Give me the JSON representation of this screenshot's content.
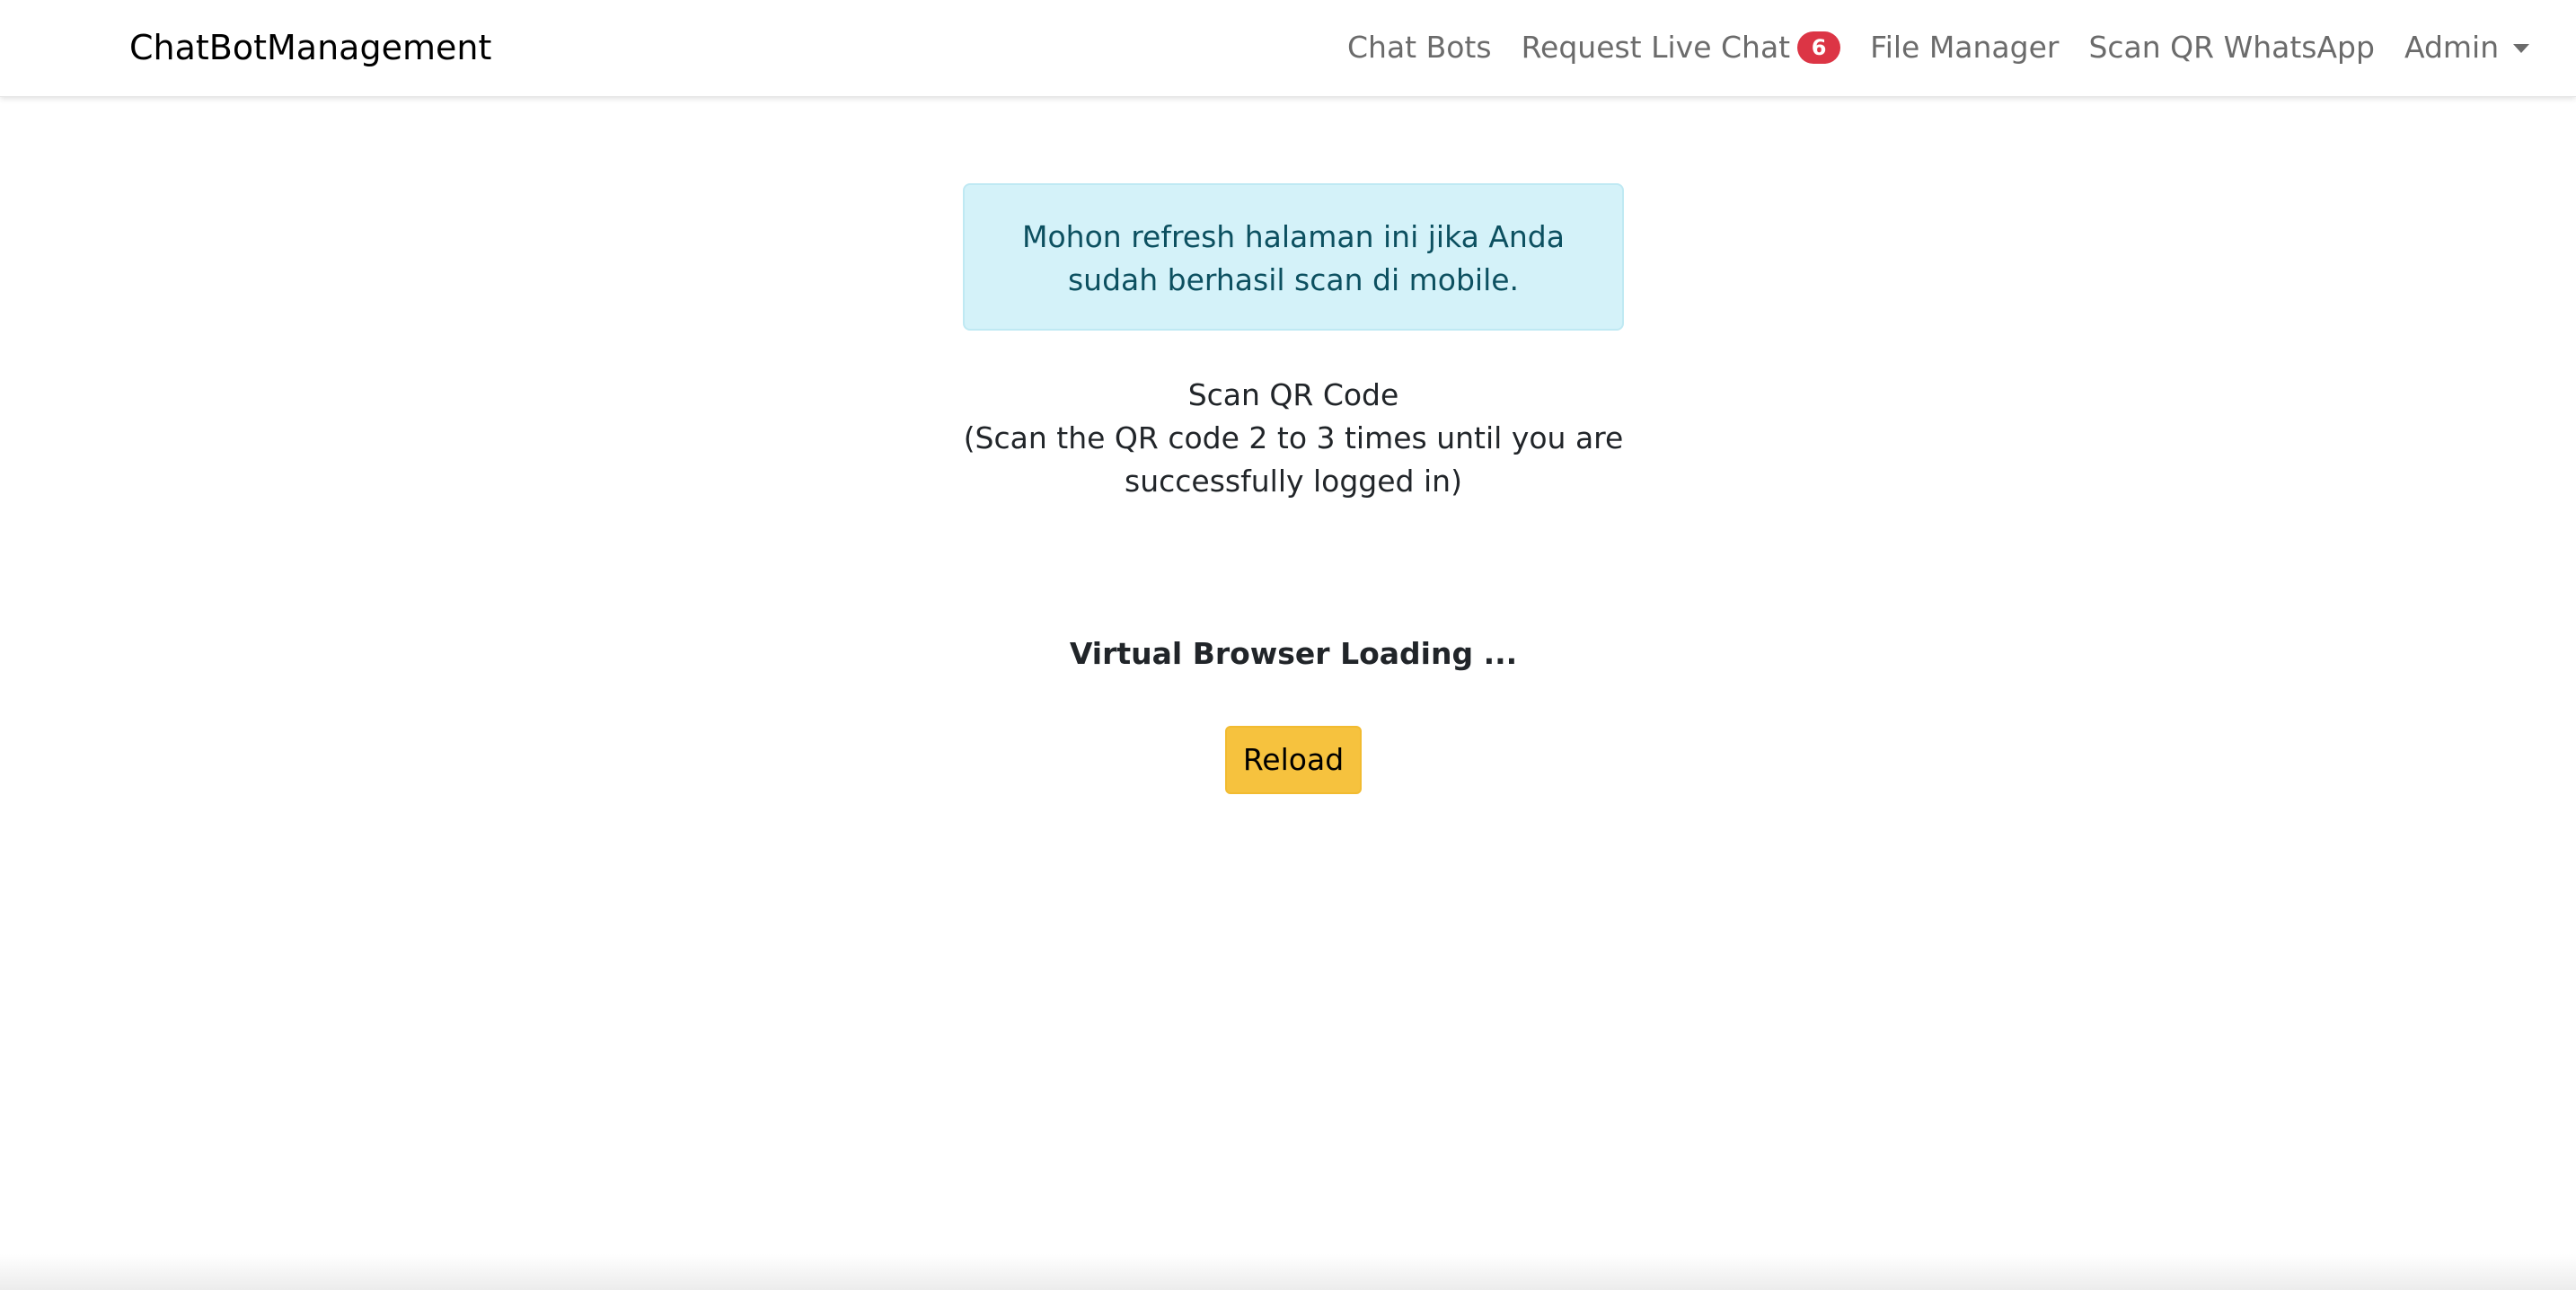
{
  "navbar": {
    "brand": "ChatBotManagement",
    "links": [
      {
        "label": "Chat Bots"
      },
      {
        "label": "Request Live Chat",
        "badge": "6"
      },
      {
        "label": "File Manager"
      },
      {
        "label": "Scan QR WhatsApp"
      },
      {
        "label": "Admin"
      }
    ]
  },
  "alert": {
    "text": "Mohon refresh halaman ini jika Anda sudah berhasil scan di mobile."
  },
  "scan": {
    "title": "Scan QR Code",
    "instruction": "(Scan the QR code 2 to 3 times until you are successfully logged in)"
  },
  "loading": {
    "text": "Virtual Browser Loading ..."
  },
  "reload_button": {
    "label": "Reload"
  },
  "colors": {
    "badge": "#dc3545",
    "alert_bg": "#d4f2f9",
    "alert_text": "#0c5060",
    "button": "#f6c23e"
  }
}
